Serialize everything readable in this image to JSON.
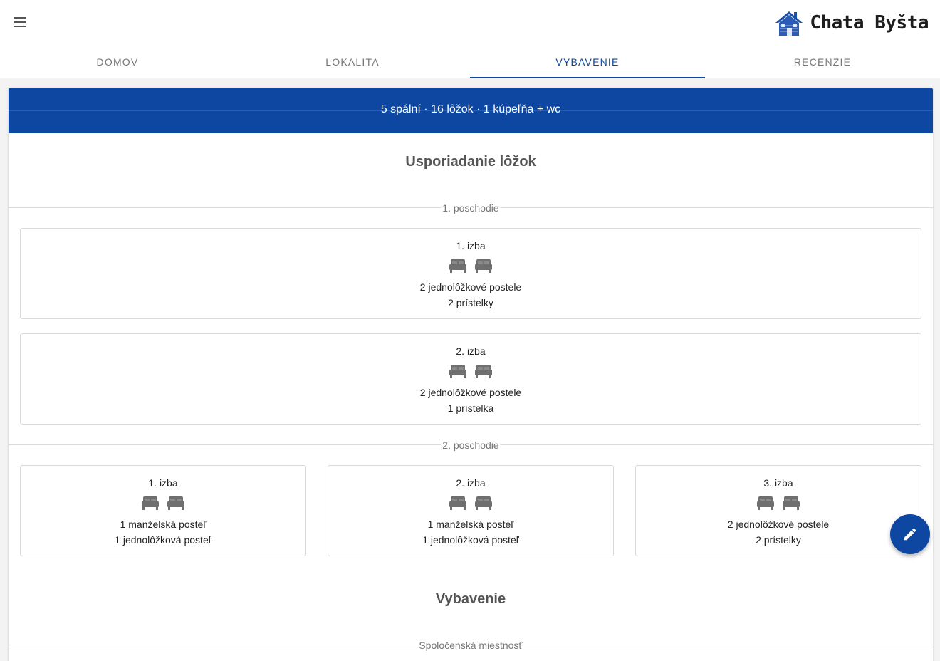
{
  "header": {
    "menu_icon": "hamburger-menu-icon",
    "brand_name": "Chata Byšta",
    "logo_icon": "cottage-logo-icon"
  },
  "tabs": [
    {
      "label": "DOMOV",
      "active": false
    },
    {
      "label": "LOKALITA",
      "active": false
    },
    {
      "label": "VYBAVENIE",
      "active": true
    },
    {
      "label": "RECENZIE",
      "active": false
    }
  ],
  "summary": "5 spální · 16 lôžok · 1 kúpeľňa + wc",
  "beds_section": {
    "title": "Usporiadanie lôžok",
    "floors": [
      {
        "label": "1. poschodie",
        "rooms": [
          {
            "name": "1. izba",
            "lines": [
              "2 jednolôžkové postele",
              "2 prístelky"
            ],
            "icon": "bed-icon"
          },
          {
            "name": "2. izba",
            "lines": [
              "2 jednolôžkové postele",
              "1 prístelka"
            ],
            "icon": "bed-icon"
          }
        ]
      },
      {
        "label": "2. poschodie",
        "rooms": [
          {
            "name": "1. izba",
            "lines": [
              "1 manželská posteľ",
              "1 jednolôžková posteľ"
            ],
            "icon": "bed-icon"
          },
          {
            "name": "2. izba",
            "lines": [
              "1 manželská posteľ",
              "1 jednolôžková posteľ"
            ],
            "icon": "bed-icon"
          },
          {
            "name": "3. izba",
            "lines": [
              "2 jednolôžkové postele",
              "2 prístelky"
            ],
            "icon": "bed-icon"
          }
        ]
      }
    ]
  },
  "equipment_section": {
    "title": "Vybavenie",
    "subsections": [
      {
        "label": "Spoločenská miestnosť"
      }
    ]
  },
  "fab": {
    "icon": "pencil-edit-icon"
  },
  "colors": {
    "primary": "#0d47a1",
    "icon_gray": "#6f6f6f",
    "text_muted": "#767676"
  }
}
